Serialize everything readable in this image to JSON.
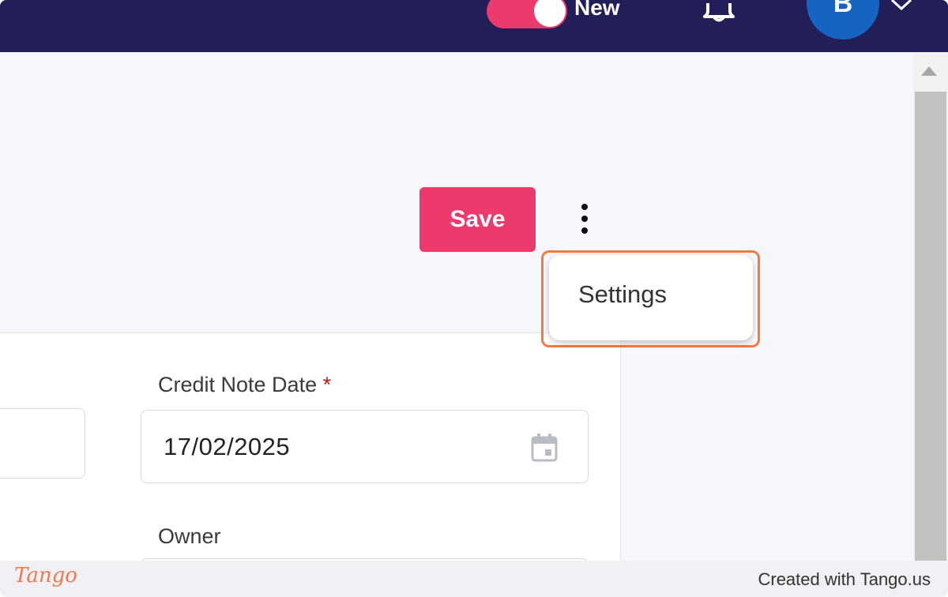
{
  "header": {
    "toggle_label": "New",
    "toggle_on": true,
    "avatar_initial": "B",
    "icons": [
      "bell-icon",
      "chevron-down-icon"
    ]
  },
  "toolbar": {
    "save_label": "Save",
    "more_icon": "kebab-menu-icon"
  },
  "dropdown_menu": {
    "items": [
      {
        "label": "Settings"
      }
    ]
  },
  "form": {
    "credit_note_date": {
      "label": "Credit Note Date",
      "required_mark": "*",
      "value": "17/02/2025",
      "icon": "calendar-icon"
    },
    "owner": {
      "label": "Owner"
    }
  },
  "footer": {
    "logo_text": "Tango",
    "credit_text": "Created with Tango.us"
  },
  "colors": {
    "topbar": "#211e58",
    "accent": "#ec3a6c",
    "avatar": "#1565c0",
    "highlight": "#f17a45"
  }
}
